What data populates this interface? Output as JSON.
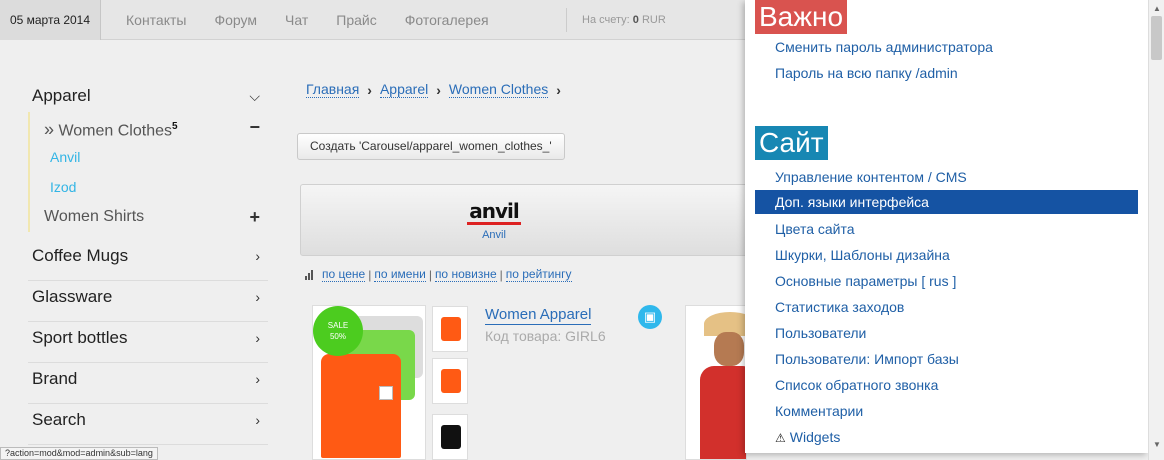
{
  "topbar": {
    "date": "05 марта 2014",
    "nav": [
      "Контакты",
      "Форум",
      "Чат",
      "Прайс",
      "Фотогалерея"
    ],
    "balance_label": "На счету:",
    "balance_value": "0",
    "balance_currency": "RUR"
  },
  "sidebar": {
    "apparel": "Apparel",
    "women_clothes": "Women Clothes",
    "women_clothes_count": "5",
    "brands": [
      "Anvil",
      "Izod"
    ],
    "women_shirts": "Women Shirts",
    "categories": [
      "Coffee Mugs",
      "Glassware",
      "Sport bottles",
      "Brand",
      "Search"
    ]
  },
  "breadcrumb": [
    "Главная",
    "Apparel",
    "Women Clothes"
  ],
  "create_button": "Создать 'Carousel/apparel_women_clothes_'",
  "carousel": {
    "logo_text": "anvil",
    "label": "Anvil"
  },
  "sort": {
    "options": [
      "по цене",
      "по имени",
      "по новизне",
      "по рейтингу"
    ]
  },
  "product": {
    "sale_label": "SALE",
    "sale_percent": "50%",
    "name": "Women Apparel",
    "code": "Код товара: GIRL6"
  },
  "status_url": "?action=mod&mod=admin&sub=lang",
  "admin_panel": {
    "important_title": "Важно",
    "important_links": [
      "Сменить пароль администратора",
      "Пароль на всю папку /admin"
    ],
    "site_title": "Сайт",
    "site_links": [
      "Управление контентом / CMS",
      "Доп. языки интерфейса",
      "Цвета сайта",
      "Шкурки, Шаблоны дизайна",
      "Основные параметры [ rus ]",
      "Статистика заходов",
      "Пользователи",
      "Пользователи: Импорт базы",
      "Список обратного звонка",
      "Комментарии",
      "Widgets"
    ],
    "active_index": 1
  },
  "colors": {
    "link": "#2a6db8",
    "important_badge": "#d9534f",
    "site_badge": "#1787b3",
    "active_row": "#1553a3",
    "sale_badge": "#4ccc1f"
  }
}
